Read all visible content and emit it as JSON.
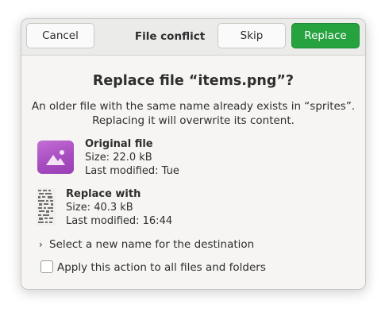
{
  "header": {
    "cancel_label": "Cancel",
    "title": "File conflict",
    "skip_label": "Skip",
    "replace_label": "Replace"
  },
  "title": "Replace file “items.png”?",
  "description": {
    "line1": "An older file with the same name already exists in “sprites”.",
    "line2": "Replacing it will overwrite its content."
  },
  "original": {
    "heading": "Original file",
    "size": "Size: 22.0 kB",
    "modified": "Last modified: Tue",
    "icon": "image-file-icon"
  },
  "replacement": {
    "heading": "Replace with",
    "size": "Size: 40.3 kB",
    "modified": "Last modified: 16:44",
    "icon": "image-thumbnail"
  },
  "expander": {
    "label": "Select a new name for the destination",
    "icon": "chevron-right-icon"
  },
  "apply_all": {
    "label": "Apply this action to all files and folders",
    "checked": false
  },
  "colors": {
    "accent": "#26a33f",
    "file_icon": "#a84dc0"
  }
}
